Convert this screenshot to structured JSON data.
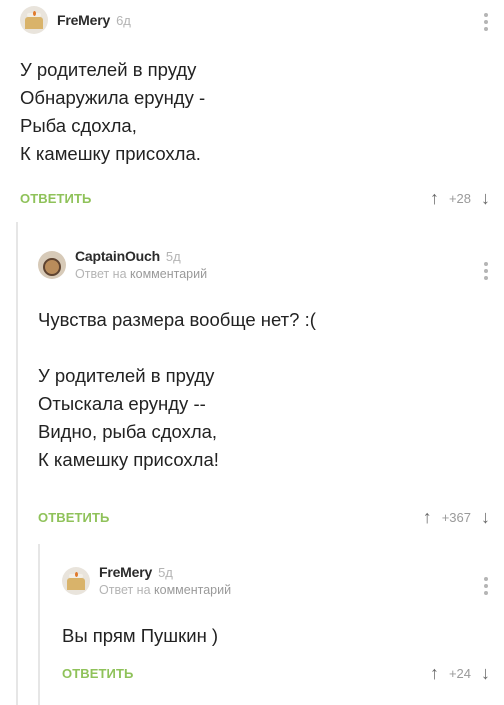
{
  "comments": [
    {
      "username": "FreMery",
      "age": "6д",
      "text": "У родителей в пруду\nОбнаружила ерунду -\nРыба сдохла,\nК камешку присохла.",
      "reply_label": "ОТВЕТИТЬ",
      "rating": "+28",
      "avatar_icon": "cake-avatar-icon"
    },
    {
      "username": "CaptainOuch",
      "age": "5д",
      "reply_to_prefix": "Ответ на",
      "reply_to_link": "комментарий",
      "text": "Чувства размера вообще нет? :(\n\nУ родителей в пруду\nОтыскала ерунду --\nВидно, рыба сдохла,\nК камешку присохла!",
      "reply_label": "ОТВЕТИТЬ",
      "rating": "+367",
      "avatar_icon": "character-avatar-icon"
    },
    {
      "username": "FreMery",
      "age": "5д",
      "reply_to_prefix": "Ответ на",
      "reply_to_link": "комментарий",
      "text": "Вы прям Пушкин )",
      "reply_label": "ОТВЕТИТЬ",
      "rating": "+24",
      "avatar_icon": "cake-avatar-icon"
    }
  ],
  "icons": {
    "upvote": "↑",
    "downvote": "↓",
    "more": "more-vertical-icon"
  },
  "colors": {
    "reply_green": "#8fc25a",
    "muted": "#b4b4b4",
    "thread_line": "#e6e6e6"
  }
}
